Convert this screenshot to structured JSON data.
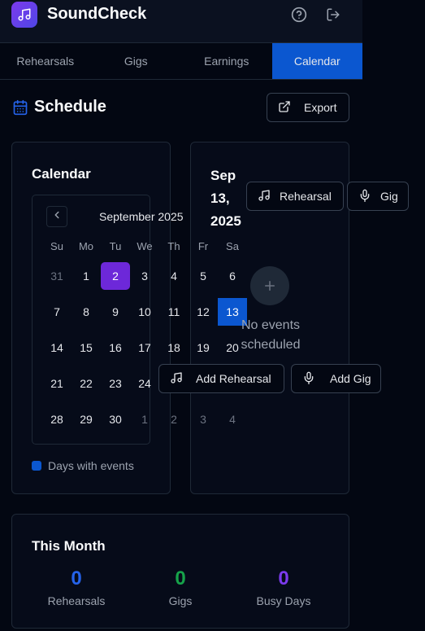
{
  "app": {
    "title": "SoundCheck"
  },
  "header": {
    "icons": [
      "help-icon",
      "logout-icon"
    ]
  },
  "tabs": [
    {
      "label": "Rehearsals",
      "active": false
    },
    {
      "label": "Gigs",
      "active": false
    },
    {
      "label": "Earnings",
      "active": false
    },
    {
      "label": "Calendar",
      "active": true
    }
  ],
  "schedule": {
    "title": "Schedule",
    "export_label": "Export"
  },
  "calendar": {
    "title": "Calendar",
    "month_label": "September 2025",
    "weekdays": [
      "Su",
      "Mo",
      "Tu",
      "We",
      "Th",
      "Fr",
      "Sa"
    ],
    "weeks": [
      [
        "31",
        "1",
        "2",
        "3",
        "4",
        "5",
        "6"
      ],
      [
        "7",
        "8",
        "9",
        "10",
        "11",
        "12",
        "13"
      ],
      [
        "14",
        "15",
        "16",
        "17",
        "18",
        "19",
        "20"
      ],
      [
        "21",
        "22",
        "23",
        "24",
        "25",
        "26",
        "27"
      ],
      [
        "28",
        "29",
        "30",
        "1",
        "2",
        "3",
        "4"
      ]
    ],
    "today": "2",
    "selected": "13",
    "legend_label": "Days with events"
  },
  "day_panel": {
    "date_label": "Sep 13, 2025",
    "rehearsal_label": "Rehearsal",
    "gig_label": "Gig",
    "empty_text": "No events scheduled",
    "add_rehearsal_label": "Add Rehearsal",
    "add_gig_label": "Add Gig"
  },
  "this_month": {
    "title": "This Month",
    "stats": [
      {
        "value": "0",
        "label": "Rehearsals",
        "color": "#2563eb"
      },
      {
        "value": "0",
        "label": "Gigs",
        "color": "#16a34a"
      },
      {
        "value": "0",
        "label": "Busy Days",
        "color": "#7c3aed"
      }
    ]
  },
  "colors": {
    "accent": "#0b57d0",
    "today": "#6d28d9",
    "background": "#030712"
  }
}
